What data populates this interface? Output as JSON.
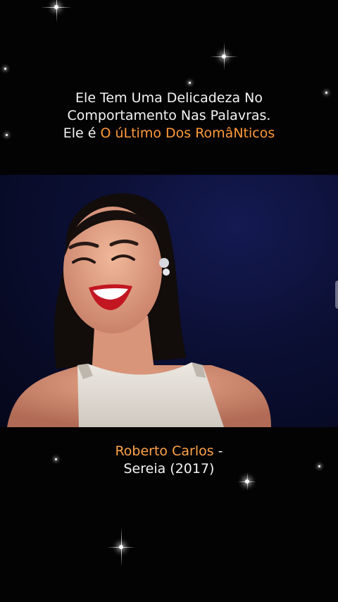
{
  "caption_top": {
    "line1": "Ele Tem Uma Delicadeza No",
    "line2": "Comportamento Nas Palavras.",
    "line3_prefix": "Ele é ",
    "line3_accent": "O úLtimo Dos RomâNticos"
  },
  "caption_bottom": {
    "artist": "Roberto Carlos",
    "separator": " -",
    "song": "Sereia (2017)"
  },
  "colors": {
    "background": "#030304",
    "text": "#f4f4f4",
    "accent": "#ff9a3a",
    "video_bg": "#0b0f33"
  }
}
